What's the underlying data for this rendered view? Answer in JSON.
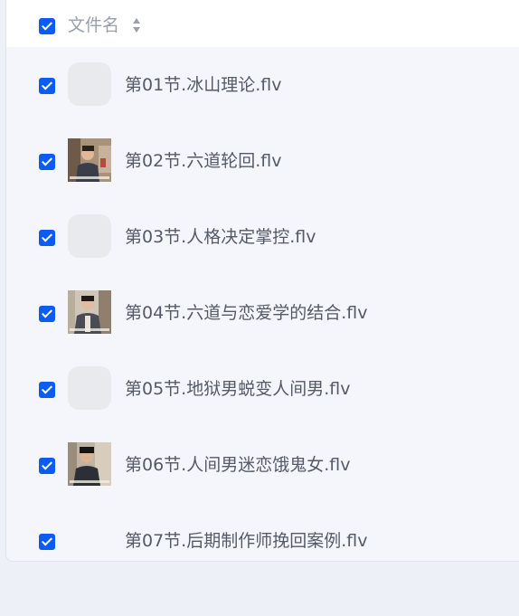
{
  "header": {
    "column_label": "文件名",
    "sort_icon": "sort-updown-icon",
    "select_all_checked": true
  },
  "files": [
    {
      "name": "第01节.冰山理论.flv",
      "checked": true,
      "thumbnail": "placeholder"
    },
    {
      "name": "第02节.六道轮回.flv",
      "checked": true,
      "thumbnail": "video-frame"
    },
    {
      "name": "第03节.人格决定掌控.flv",
      "checked": true,
      "thumbnail": "placeholder"
    },
    {
      "name": "第04节.六道与恋爱学的结合.flv",
      "checked": true,
      "thumbnail": "video-frame"
    },
    {
      "name": "第05节.地狱男蜕变人间男.flv",
      "checked": true,
      "thumbnail": "placeholder"
    },
    {
      "name": "第06节.人间男迷恋饿鬼女.flv",
      "checked": true,
      "thumbnail": "video-frame"
    },
    {
      "name": "第07节.后期制作师挽回案例.flv",
      "checked": true,
      "thumbnail": "none"
    }
  ],
  "colors": {
    "checkbox": "#0a5cf5",
    "row_background": "#f5f6fc",
    "header_background": "#ffffff",
    "text": "#545a66"
  }
}
